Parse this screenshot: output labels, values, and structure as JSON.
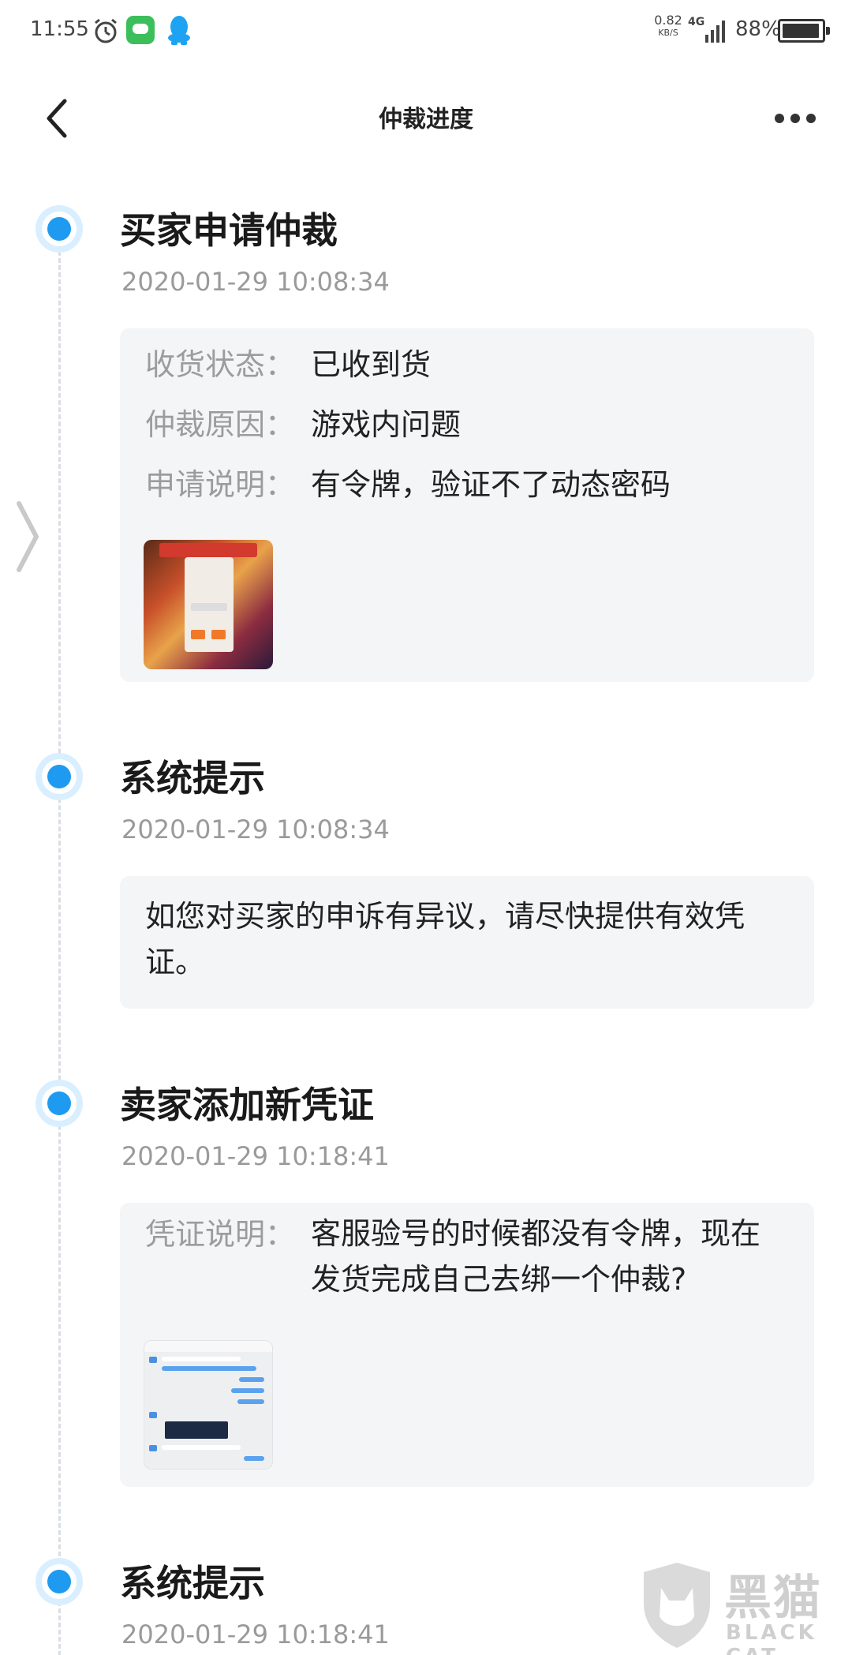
{
  "status_bar": {
    "time": "11:55",
    "net_speed": "0.82",
    "net_unit": "KB/S",
    "network_type": "4G",
    "battery_percent": "88%",
    "icons": [
      "alarm-icon",
      "message-app-icon",
      "qq-icon",
      "signal-icon",
      "battery-icon"
    ]
  },
  "nav": {
    "title": "仲裁进度",
    "back_icon": "chevron-left-icon",
    "more_icon": "more-dots-icon"
  },
  "events": [
    {
      "title": "买家申请仲裁",
      "time": "2020-01-29 10:08:34",
      "rows": [
        {
          "key": "收货状态：",
          "value": "已收到货"
        },
        {
          "key": "仲裁原因：",
          "value": "游戏内问题"
        },
        {
          "key": "申请说明：",
          "value": "有令牌，验证不了动态密码"
        }
      ],
      "attachment": "game-screenshot-thumbnail"
    },
    {
      "title": "系统提示",
      "time": "2020-01-29 10:08:34",
      "text": "如您对买家的申诉有异议，请尽快提供有效凭证。"
    },
    {
      "title": "卖家添加新凭证",
      "time": "2020-01-29 10:18:41",
      "rows": [
        {
          "key": "凭证说明：",
          "value": "客服验号的时候都没有令牌，现在发货完成自己去绑一个仲裁?"
        }
      ],
      "attachment": "chat-screenshot-thumbnail"
    },
    {
      "title": "系统提示",
      "time": "2020-01-29 10:18:41"
    }
  ],
  "watermark": {
    "text": "黑猫",
    "sub": "BLACK CAT"
  },
  "colors": {
    "accent": "#1e9bf0",
    "card_bg": "#f4f5f7",
    "label_gray": "#9c9c9c"
  }
}
